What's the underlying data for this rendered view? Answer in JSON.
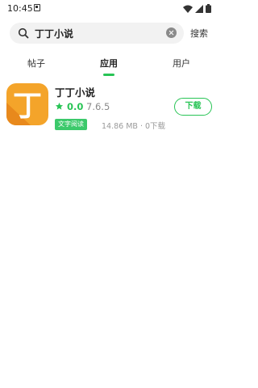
{
  "status_bar": {
    "time": "10:45",
    "icons": [
      "notification-icon",
      "wifi-icon",
      "signal-icon",
      "battery-icon"
    ]
  },
  "search": {
    "query": "丁丁小说",
    "button_label": "搜索"
  },
  "tabs": [
    {
      "label": "帖子",
      "active": false
    },
    {
      "label": "应用",
      "active": true
    },
    {
      "label": "用户",
      "active": false
    }
  ],
  "results": [
    {
      "name": "丁丁小说",
      "icon_glyph": "丁",
      "rating": "0.0",
      "version": "7.6.5",
      "tag": "文字阅读",
      "meta": "14.86 MB · 0下载",
      "download_label": "下载"
    }
  ],
  "colors": {
    "accent": "#28c455",
    "icon_bg": "#f4a42a",
    "tag_bg": "#3cc96b"
  }
}
